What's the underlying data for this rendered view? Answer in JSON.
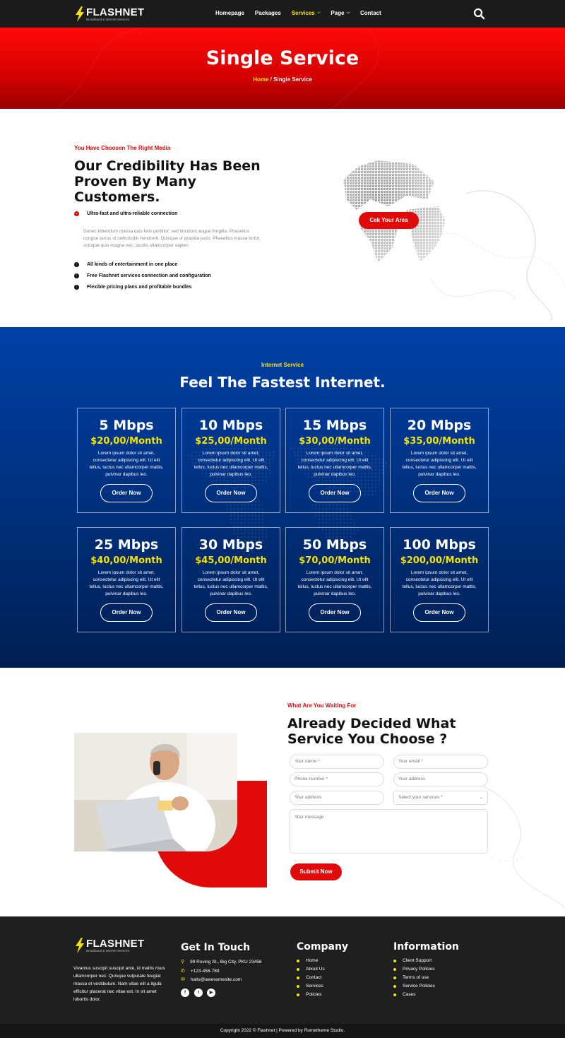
{
  "brand": {
    "name": "FLASHNET",
    "tagline": "Broadband & Internet Services"
  },
  "nav": {
    "items": [
      {
        "label": "Homepage",
        "active": false,
        "dropdown": false
      },
      {
        "label": "Packages",
        "active": false,
        "dropdown": false
      },
      {
        "label": "Services",
        "active": true,
        "dropdown": true
      },
      {
        "label": "Page",
        "active": false,
        "dropdown": true
      },
      {
        "label": "Contact",
        "active": false,
        "dropdown": false
      }
    ]
  },
  "hero": {
    "title": "Single Service",
    "crumb_home": "Home",
    "crumb_sep": " / ",
    "crumb_current": "Single Service"
  },
  "credibility": {
    "eyebrow": "You Have Choosen The Right Media",
    "title_lines": [
      "Our Credibility Has Been",
      "Proven By Many",
      "Customers."
    ],
    "first_feature": "Ultra-fast and ultra-reliable connection",
    "body_lines": [
      "Donec bibendum massa quis felis porttitor, sed tincidunt augue fringilla. Phasellus",
      "congue purus ut sollicitudin hendrerit. Quisque ut gravida justo. Phasellus massa tortor,",
      "volutpat quis magna nec, iaculis ullamcorper sapien."
    ],
    "features": [
      "All kinds of entertainment in one place",
      "Free Flashnet services connection and configuration",
      "Flexible pricing plans and profitable bundles"
    ],
    "cta": "Cek Your Area"
  },
  "pricing": {
    "eyebrow": "Internet Service",
    "title": "Feel The Fastest Internet.",
    "desc_lines": [
      "Lorem ipsum dolor sit amet,",
      "consectetur adipiscing elit. Ut elit",
      "tellus, luctus nec ullamcorper mattis,",
      "pulvinar dapibus leo."
    ],
    "order_label": "Order Now",
    "plans": [
      {
        "speed": "5 Mbps",
        "price": "$20,00/Month"
      },
      {
        "speed": "10 Mbps",
        "price": "$25,00/Month"
      },
      {
        "speed": "15 Mbps",
        "price": "$30,00/Month"
      },
      {
        "speed": "20 Mbps",
        "price": "$35,00/Month"
      },
      {
        "speed": "25 Mbps",
        "price": "$40,00/Month"
      },
      {
        "speed": "30 Mbps",
        "price": "$45,00/Month"
      },
      {
        "speed": "50 Mbps",
        "price": "$70,00/Month"
      },
      {
        "speed": "100 Mbps",
        "price": "$200,00/Month"
      }
    ]
  },
  "order_form": {
    "eyebrow": "What Are You Waiting For",
    "title_lines": [
      "Already Decided What",
      "Service You Choose ?"
    ],
    "placeholders": {
      "name": "Your name *",
      "email": "Your email *",
      "phone": "Phone number *",
      "address1": "Your address",
      "address2": "Your address",
      "service": "Select your services *",
      "message": "Your message"
    },
    "submit": "Submit Now"
  },
  "footer": {
    "about_lines": [
      "Vivamus suscipit suscipit ante, id mattis risus",
      "ullamcorper nec. Quisque vulputate feugiat",
      "massa et vestibulum. Nam vitae elit a ligula",
      "efficitur placerat nec vitae est. In sit amet",
      "lobortis dolor."
    ],
    "contact_title": "Get In Touch",
    "address": "99 Roving St., Big City, PKU 23456",
    "phone": "+123-456-789",
    "email": "hallo@awesomesite.com",
    "company_title": "Company",
    "company_links": [
      "Home",
      "About Us",
      "Contact",
      "Services",
      "Policies"
    ],
    "info_title": "Information",
    "info_links": [
      "Client Support",
      "Privacy Policies",
      "Terms of use",
      "Service Policies",
      "Cases"
    ],
    "copyright": "Copyright 2022 © Flashnet | Powered by Rometheme Studio."
  },
  "colors": {
    "accent_red": "#e10a0a",
    "accent_yellow": "#f5e400",
    "navy": "#00317f",
    "dark": "#1b1b1b"
  }
}
